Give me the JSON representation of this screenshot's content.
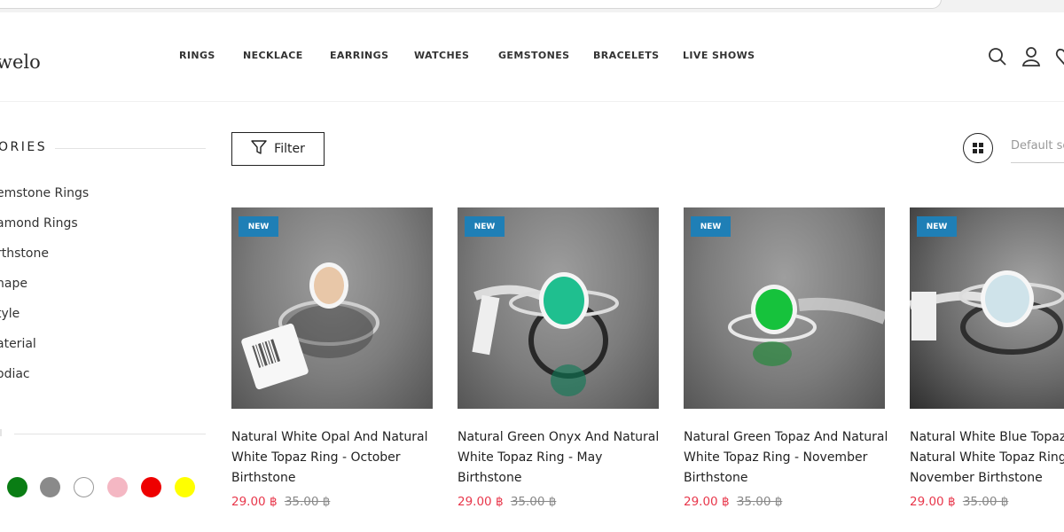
{
  "brand": {
    "logo_text": "welo"
  },
  "nav": [
    {
      "label": "RINGS"
    },
    {
      "label": "NECKLACE"
    },
    {
      "label": "EARRINGS"
    },
    {
      "label": "WATCHES"
    },
    {
      "label": "GEMSTONES"
    },
    {
      "label": "BRACELETS"
    },
    {
      "label": "LIVE SHOWS"
    }
  ],
  "header_icons": [
    "search-icon",
    "user-icon",
    "heart-icon"
  ],
  "sidebar": {
    "categories_title": "ORIES",
    "categories": [
      {
        "label": "emstone Rings"
      },
      {
        "label": "amond Rings"
      },
      {
        "label": "rthstone"
      },
      {
        "label": "hape"
      },
      {
        "label": "tyle"
      },
      {
        "label": "aterial"
      },
      {
        "label": "odiac"
      }
    ],
    "colors": [
      {
        "name": "green",
        "hex": "#0a7d14"
      },
      {
        "name": "gray",
        "hex": "#8a8a8a"
      },
      {
        "name": "white",
        "hex": "#ffffff"
      },
      {
        "name": "pink",
        "hex": "#f4b7c3"
      },
      {
        "name": "red",
        "hex": "#ee0000"
      },
      {
        "name": "yellow",
        "hex": "#ffff00"
      }
    ]
  },
  "toolbar": {
    "filter_label": "Filter",
    "sort_label": "Default sc"
  },
  "products": [
    {
      "badge": "NEW",
      "title": "Natural White Opal And Natural White Topaz Ring - October Birthstone",
      "price": "29.00 ฿",
      "old_price": "35.00 ฿",
      "stone_color": "#e8c7a8"
    },
    {
      "badge": "NEW",
      "title": "Natural Green Onyx And Natural White Topaz Ring - May Birthstone",
      "price": "29.00 ฿",
      "old_price": "35.00 ฿",
      "stone_color": "#1fbf8f"
    },
    {
      "badge": "NEW",
      "title": "Natural Green Topaz And Natural White Topaz Ring - November Birthstone",
      "price": "29.00 ฿",
      "old_price": "35.00 ฿",
      "stone_color": "#16c23c"
    },
    {
      "badge": "NEW",
      "title": "Natural White Blue Topaz And Natural White Topaz Ring - November Birthstone",
      "price": "29.00 ฿",
      "old_price": "35.00 ฿",
      "stone_color": "#cfe3ea"
    }
  ],
  "colors": {
    "accent_blue": "#1f7fb6",
    "price_red": "#e8374b"
  }
}
